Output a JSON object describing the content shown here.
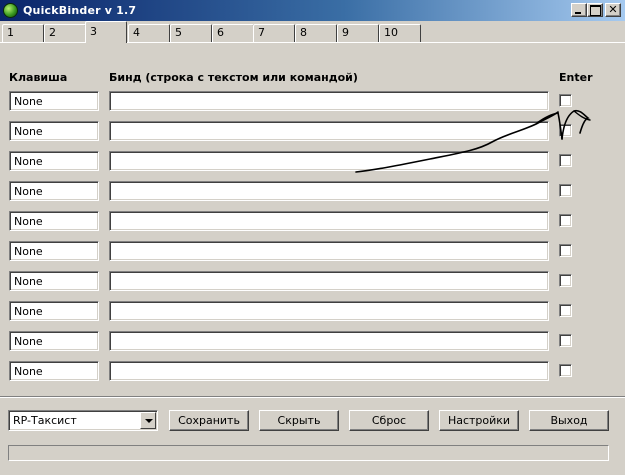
{
  "window": {
    "title": "QuickBinder v 1.7"
  },
  "tabs": [
    {
      "label": "1"
    },
    {
      "label": "2"
    },
    {
      "label": "3"
    },
    {
      "label": "4"
    },
    {
      "label": "5"
    },
    {
      "label": "6"
    },
    {
      "label": "7"
    },
    {
      "label": "8"
    },
    {
      "label": "9"
    },
    {
      "label": "10"
    }
  ],
  "active_tab": "3",
  "columns": {
    "key": "Клавиша",
    "bind": "Бинд (строка с текстом или командой)",
    "enter": "Enter"
  },
  "rows": [
    {
      "key": "None",
      "bind": "",
      "enter": false
    },
    {
      "key": "None",
      "bind": "",
      "enter": false
    },
    {
      "key": "None",
      "bind": "",
      "enter": false
    },
    {
      "key": "None",
      "bind": "",
      "enter": false
    },
    {
      "key": "None",
      "bind": "",
      "enter": false
    },
    {
      "key": "None",
      "bind": "",
      "enter": false
    },
    {
      "key": "None",
      "bind": "",
      "enter": false
    },
    {
      "key": "None",
      "bind": "",
      "enter": false
    },
    {
      "key": "None",
      "bind": "",
      "enter": false
    },
    {
      "key": "None",
      "bind": "",
      "enter": false
    }
  ],
  "profile": {
    "selected": "RP-Таксист"
  },
  "buttons": {
    "save": "Сохранить",
    "hide": "Скрыть",
    "reset": "Сброс",
    "settings": "Настройки",
    "exit": "Выход"
  },
  "icons": {
    "app": "app-icon",
    "minimize": "minimize-icon",
    "maximize": "maximize-icon",
    "close": "close-icon",
    "dropdown": "chevron-down-icon"
  },
  "colors": {
    "titlebar_start": "#0a246a",
    "titlebar_end": "#a6caf0",
    "face": "#d4d0c8",
    "annotation": "#000000"
  }
}
